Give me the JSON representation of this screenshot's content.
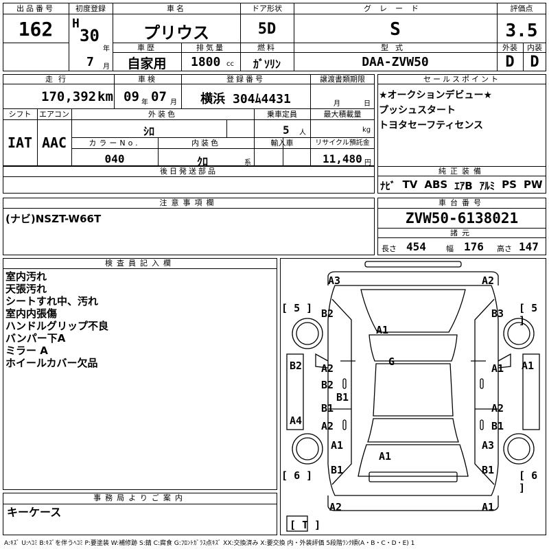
{
  "top": {
    "lot_label": "出品番号",
    "lot_number": "162",
    "first_reg_label": "初度登録",
    "era": "H",
    "year": "30",
    "year_unit": "年",
    "month": "7",
    "month_unit": "月",
    "car_name_label": "車名",
    "car_name": "プリウス",
    "door_label": "ドア形状",
    "door": "5D",
    "grade_label": "グレード",
    "grade": "S",
    "score_label": "評価点",
    "score": "3.5",
    "history_label": "車歴",
    "history": "自家用",
    "displacement_label": "排気量",
    "displacement": "1800",
    "displacement_unit": "cc",
    "fuel_label": "燃料",
    "fuel": "ｶﾞｿﾘﾝ",
    "model_label": "型式",
    "model": "DAA-ZVW50",
    "exterior_label": "外装",
    "exterior": "D",
    "interior_label": "内装",
    "interior": "D"
  },
  "mid": {
    "mileage_label": "走行",
    "mileage": "170,392",
    "mileage_unit": "km",
    "inspection_label": "車検",
    "inspection_year": "09",
    "inspection_year_unit": "年",
    "inspection_month": "07",
    "inspection_month_unit": "月",
    "reg_no_label": "登録番号",
    "reg_no": "横浜 304ﾑ4431",
    "transfer_label": "譲渡書類期限",
    "transfer_month_unit": "月",
    "transfer_day_unit": "日",
    "shift_label": "シフト",
    "shift": "IAT",
    "ac_label": "エアコン",
    "ac": "AAC",
    "ext_color_label": "外装色",
    "ext_color": "ｼﾛ",
    "capacity_label": "乗車定員",
    "capacity": "5",
    "capacity_unit": "人",
    "max_load_label": "最大積載量",
    "max_load_unit": "kg",
    "color_no_label": "カラーNo.",
    "color_no": "040",
    "int_color_label": "内装色",
    "int_color": "ｸﾛ",
    "int_color_unit": "系",
    "import_label": "輸入車",
    "recycle_label": "リサイクル預託金",
    "recycle": "11,480",
    "recycle_unit": "円",
    "later_parts_label": "後日発送部品"
  },
  "sales": {
    "label": "セールスポイント",
    "points": [
      "★オークションデビュー★",
      "プッシュスタート",
      "トヨタセーフティセンス"
    ]
  },
  "equipment": {
    "label": "純正装備",
    "items": [
      "ﾅﾋﾞ",
      "TV",
      "ABS",
      "ｴｱB",
      "ｱﾙﾐ",
      "PS",
      "PW"
    ]
  },
  "notes": {
    "label": "注意事項欄",
    "text": "(ナビ)NSZT-W66T"
  },
  "chassis": {
    "label": "車台番号",
    "number": "ZVW50-6138021",
    "dims_label": "諸元",
    "length_label": "長さ",
    "length": "454",
    "width_label": "幅",
    "width": "176",
    "height_label": "高さ",
    "height": "147"
  },
  "inspector": {
    "label": "検査員記入欄",
    "lines": [
      "室内汚れ",
      "天張汚れ",
      "シートすれ中、汚れ",
      "室内内張傷",
      "ハンドルグリップ不良",
      "バンパー下A",
      "ミラー A",
      "ホイールカバー欠品"
    ]
  },
  "office": {
    "label": "事務局よりご案内",
    "text": "キーケース"
  },
  "legend": "A:ｷｽﾞ U:ﾍｺﾐ B:ｷｽﾞを伴うﾍｺﾐ P:要塗装 W:補修跡 S:錆 C:腐食 G:ﾌﾛﾝﾄｶﾞﾗｽ点ｷｽﾞ XX:交換済み X:要交換 内・外装評価 5段階ﾗﾝｸ順(A・B・C・D・E) 1",
  "diagram": {
    "tire_fl": "5",
    "tire_fr": "5",
    "tire_rl": "6",
    "tire_rr": "6",
    "tire_spare": "T",
    "marks": {
      "front_bumper_left": "A3",
      "front_bumper_right": "A2",
      "front_fender_left": "B2",
      "front_fender_right": "B3",
      "bonnet": "A1",
      "windshield": "G",
      "left_mirror_area": "B2",
      "right_side_outer": "A1",
      "left_front_door_a": "A2",
      "left_front_door_b": "B2",
      "left_rocker": "B1",
      "right_front_door": "A1",
      "left_rear_door_a": "B1",
      "left_rear_door_b": "A2",
      "left_side_outer": "A4",
      "right_rear_door_a": "A2",
      "right_rear_door_b": "B1",
      "left_quarter": "A1",
      "right_quarter": "A3",
      "trunk": "A1",
      "left_rear_lower": "B1",
      "right_rear_lower": "B1",
      "rear_bumper_left": "A2",
      "rear_bumper_right": "A1"
    }
  }
}
